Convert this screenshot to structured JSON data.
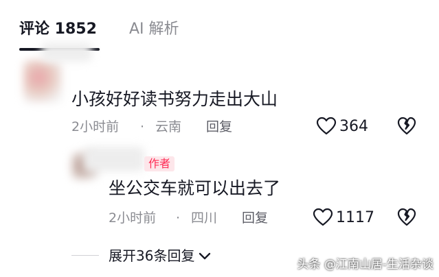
{
  "tabs": [
    {
      "label": "评论 1852",
      "active": true
    },
    {
      "label": "AI 解析",
      "active": false
    }
  ],
  "comments": [
    {
      "text": "小孩好好读书努力走出大山",
      "time": "2小时前",
      "separator": "·",
      "location": "云南",
      "reply_label": "回复",
      "likes": "364"
    }
  ],
  "replies": [
    {
      "author_badge": "作者",
      "text": "坐公交车就可以出去了",
      "time": "2小时前",
      "separator": "·",
      "location": "四川",
      "reply_label": "回复",
      "likes": "1117"
    }
  ],
  "expand": {
    "label": "展开36条回复"
  },
  "watermark": "头条 @江南山居-生活杂谈",
  "colors": {
    "text": "#161823",
    "muted": "#8a8b91",
    "accent": "#fe2c55",
    "badge_bg": "#fde6ea"
  },
  "icons": [
    "heart-icon",
    "broken-heart-icon",
    "chevron-down-icon"
  ]
}
